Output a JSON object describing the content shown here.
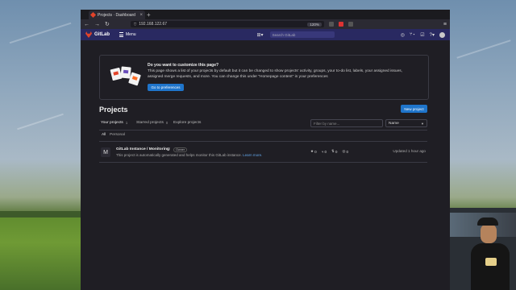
{
  "browser": {
    "tab_title": "Projects · Dashboard · Git",
    "tab_close": "×",
    "new_tab": "+",
    "url": "192.168.122.67",
    "zoom": "120%"
  },
  "header": {
    "app_name": "GitLab",
    "menu_label": "Menu",
    "search_placeholder": "Search GitLab"
  },
  "promo": {
    "title": "Do you want to customize this page?",
    "body": "This page shows a list of your projects by default but it can be changed to show projects' activity, groups, your to-do list, labels, your assigned issues, assigned merge requests, and more. You can change this under \"Homepage content\" in your preferences",
    "button": "Go to preferences"
  },
  "projects": {
    "heading": "Projects",
    "new_button": "New project",
    "tabs": [
      {
        "label": "Your projects",
        "count": "1"
      },
      {
        "label": "Starred projects",
        "count": "0"
      },
      {
        "label": "Explore projects",
        "count": ""
      }
    ],
    "filter_placeholder": "Filter by name...",
    "sort_value": "Name",
    "sub_tabs": [
      "All",
      "Personal"
    ],
    "list": [
      {
        "avatar_letter": "M",
        "name": "GitLab Instance / Monitoring",
        "badge": "Owner",
        "description": "This project is automatically generated and helps monitor this GitLab instance.",
        "learn_more": "Learn more.",
        "stars": "0",
        "forks": "0",
        "merge_requests": "0",
        "issues": "0",
        "updated": "Updated 1 hour ago"
      }
    ]
  },
  "colors": {
    "header_bg": "#292961",
    "accent_blue": "#1f75cb",
    "gitlab_orange": "#e24329",
    "page_bg": "#1f1e24"
  }
}
